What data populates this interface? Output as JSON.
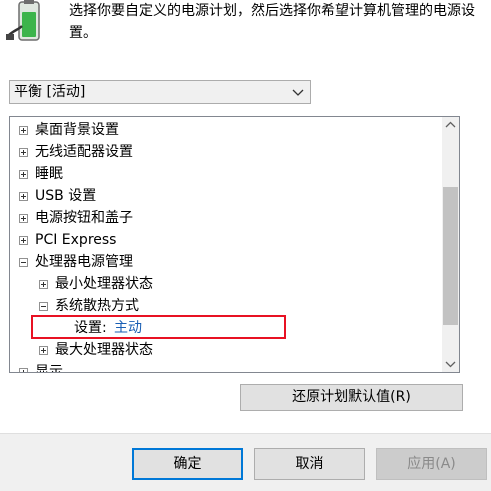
{
  "header": {
    "icon": "battery-power-plug-icon",
    "description": "选择你要自定义的电源计划，然后选择你希望计算机管理的电源设置。"
  },
  "plan_select": {
    "value": "平衡 [活动]",
    "icon": "chevron-down-icon"
  },
  "tree": {
    "items": [
      {
        "label": "桌面背景设置",
        "state": "collapsed"
      },
      {
        "label": "无线适配器设置",
        "state": "collapsed"
      },
      {
        "label": "睡眠",
        "state": "collapsed"
      },
      {
        "label": "USB 设置",
        "state": "collapsed"
      },
      {
        "label": "电源按钮和盖子",
        "state": "collapsed"
      },
      {
        "label": "PCI Express",
        "state": "collapsed"
      },
      {
        "label": "处理器电源管理",
        "state": "expanded"
      },
      {
        "label": "最小处理器状态",
        "state": "collapsed"
      },
      {
        "label": "系统散热方式",
        "state": "expanded"
      },
      {
        "label": "设置:",
        "value": "主动"
      },
      {
        "label": "最大处理器状态",
        "state": "collapsed"
      },
      {
        "label": "显示",
        "state": "collapsed"
      }
    ],
    "highlight_color": "#e81123",
    "value_color": "#1a5fb4"
  },
  "restore_button": "还原计划默认值(R)",
  "footer": {
    "ok": "确定",
    "cancel": "取消",
    "apply": "应用(A)"
  }
}
